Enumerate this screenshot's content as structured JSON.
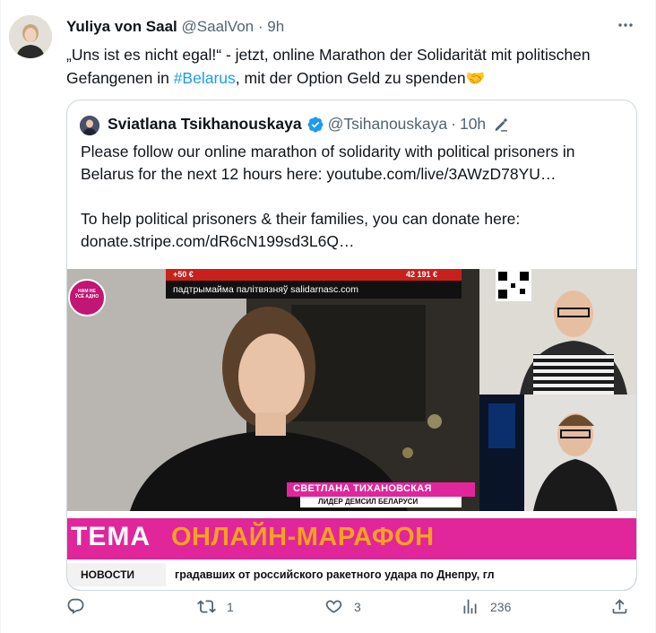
{
  "author": {
    "name": "Yuliya von Saal",
    "handle": "@SaalVon",
    "separator": "·",
    "time": "9h"
  },
  "tweet": {
    "text_part1": "„Uns ist es nicht egal!“ - jetzt, online Marathon der Solidarität mit politischen Gefangenen in ",
    "hashtag": "#Belarus",
    "text_part2": ", mit der Option Geld zu spenden",
    "emoji": "🤝"
  },
  "quoted": {
    "name": "Sviatlana Tsikhanouskaya",
    "handle": "@Tsihanouskaya",
    "separator": "·",
    "time": "10h",
    "paragraph1": "Please follow our online marathon of solidarity with political prisoners in Belarus for the next 12 hours here: youtube.com/live/3AWzD78YU…",
    "paragraph2": "To help political prisoners & their families, you can donate here: donate.stripe.com/dR6cN199sd3L6Q…"
  },
  "video": {
    "left_counter": "+50 €",
    "right_counter": "42 191 €",
    "ticker_url": "падтрымайма палітвязняў salidarnasc.com",
    "logo_text": "НАМ НЕ ЎСЁ АДНО",
    "speaker_name": "СВЕТЛАНА ТИХАНОВСКАЯ",
    "speaker_title": "ЛИДЕР ДЕМСИЛ БЕЛАРУСИ",
    "topic_label": "ТЕМА",
    "topic_value": "ОНЛАЙН-МАРАФОН",
    "news_label": "НОВОСТИ",
    "news_ticker": "градавших от российского ракетного удара по Днепру, гл"
  },
  "actions": {
    "reply_count": "",
    "retweet_count": "1",
    "like_count": "3",
    "views_count": "236"
  },
  "colors": {
    "link": "#1d9bf0",
    "secondary_text": "#536471",
    "magenta": "#e0269a",
    "topic_orange": "#f6a21e",
    "verified": "#1d9bf0"
  }
}
